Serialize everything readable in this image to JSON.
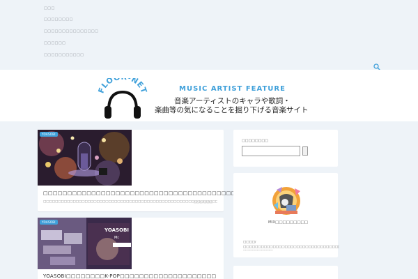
{
  "nav": {
    "items": [
      "□□□",
      "□□□□□□□□",
      "□□□□□□□□□□□□□□□",
      "□□□□□□",
      "□□□□□□□□□□□"
    ]
  },
  "header": {
    "logo_text": "FLOOR-NET",
    "subtitle": "MUSIC ARTIST FEATURE",
    "tagline_1": "音楽アーティストのキャラや歌詞・",
    "tagline_2": "楽曲等の気になることを掘り下げる音楽サイト"
  },
  "posts": [
    {
      "tag": "YOASOBI",
      "title": "□□□□□□□□□□□□□□□□□□□□□□□□□□□□□□□□□□□□□□□□□□□",
      "excerpt": "□□□□□□□□□□□□□□□□□□□□□□□□□□□□□□□□□□□□□□□□□□□□□□□□□□□□□□□□□□□□□□□□□□□□□□□□□□□□□□□□□…",
      "more": "□□□ □□□"
    },
    {
      "tag": "YOASOBI",
      "thumb_text_1": "YOASOBI",
      "thumb_text_2": "Mr.",
      "title": "YOASOBI□□□□□□□□K-POP□□□□□□□□□□□□□□□□□□□□"
    }
  ],
  "sidebar": {
    "search_title": "□□□□□□□□",
    "profile_name": "MIX□□□□□□□□□",
    "profile_desc": "□□□□/ □□□□□□□□□□□□□□□□□□□□□□□□□□□□□□□□□□□□□□□□□□□□□□□□□□□ □□□□□□□□□□"
  },
  "colors": {
    "accent": "#3fa0da",
    "page_bg": "#eef3f8"
  }
}
